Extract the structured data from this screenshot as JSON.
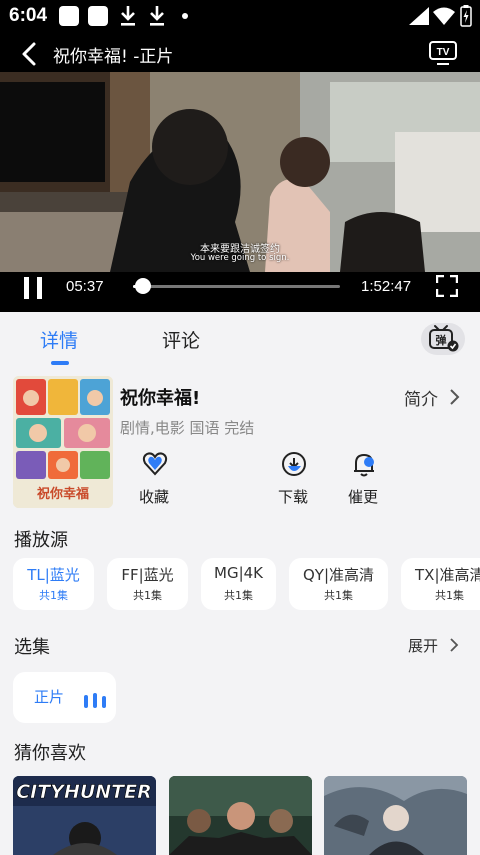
{
  "status_bar": {
    "time": "6:04"
  },
  "header": {
    "title": "祝你幸福! -正片"
  },
  "player": {
    "subtitle_cn": "本来要跟洁诚签约",
    "subtitle_en": "You were going to sign.",
    "current_time": "05:37",
    "total_time": "1:52:47",
    "progress": 0.05
  },
  "tabs": {
    "detail": "详情",
    "comment": "评论"
  },
  "movie": {
    "title": "祝你幸福!",
    "intro_label": "简介",
    "meta": "剧情,电影 国语 完结",
    "poster_text": "祝你幸福"
  },
  "actions": {
    "favorite": "收藏",
    "download": "下载",
    "remind": "催更"
  },
  "sources": {
    "title": "播放源",
    "items": [
      {
        "name": "TL|蓝光",
        "count": "共1集",
        "active": true
      },
      {
        "name": "FF|蓝光",
        "count": "共1集",
        "active": false
      },
      {
        "name": "MG|4K",
        "count": "共1集",
        "active": false
      },
      {
        "name": "QY|准高清",
        "count": "共1集",
        "active": false
      },
      {
        "name": "TX|准高清",
        "count": "共1集",
        "active": false
      }
    ]
  },
  "episodes": {
    "title": "选集",
    "expand_label": "展开",
    "items": [
      {
        "label": "正片"
      }
    ]
  },
  "recommend": {
    "title": "猜你喜欢",
    "items": [
      {
        "logo": "CITYHUNTER"
      },
      {
        "logo": ""
      },
      {
        "logo": ""
      }
    ]
  },
  "colors": {
    "accent": "#2e7cf6",
    "background": "#f3f3f5",
    "card": "#ffffff"
  },
  "icons": [
    "back-icon",
    "tv-cast-icon",
    "pause-icon",
    "fullscreen-icon",
    "danmaku-icon",
    "heart-icon",
    "download-icon",
    "bell-icon",
    "chevron-right-icon",
    "equalizer-icon"
  ]
}
